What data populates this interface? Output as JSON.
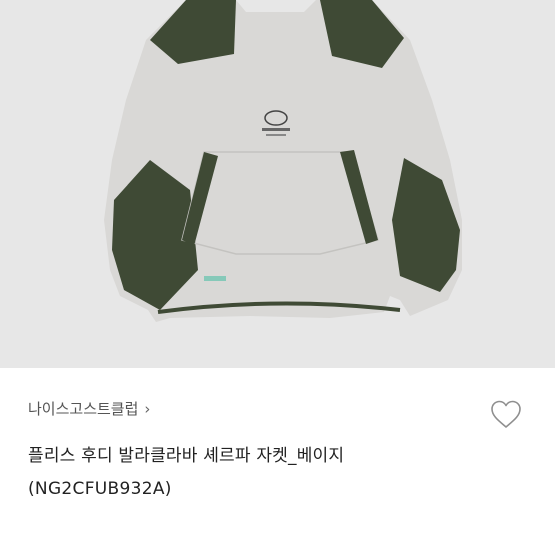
{
  "product": {
    "brand": "나이스고스트클럽",
    "brand_chevron": "›",
    "title": "플리스 후디 발라클라바 셰르파 자켓_베이지",
    "code": "(NG2CFUB932A)",
    "image_icon": "fleece-sweater-image",
    "wishlist_icon": "heart-outline-icon",
    "colors": {
      "background": "#e7e7e7",
      "body": "#d8d7d5",
      "panel": "#3f4a35",
      "tag": "#86c9b9"
    }
  }
}
